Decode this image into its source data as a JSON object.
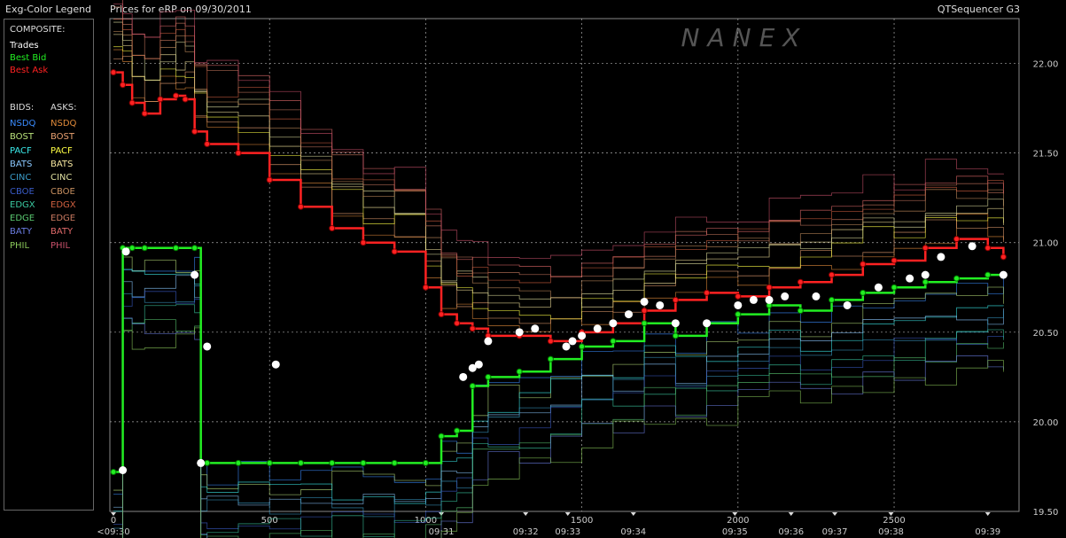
{
  "legend": {
    "title": "Exg-Color Legend",
    "composite_label": "COMPOSITE:",
    "composite": [
      {
        "label": "Trades",
        "color": "#ffffff"
      },
      {
        "label": "Best Bid",
        "color": "#22ee22"
      },
      {
        "label": "Best Ask",
        "color": "#ff2222"
      }
    ],
    "bids_label": "BIDS:",
    "asks_label": "ASKS:",
    "exchanges": [
      {
        "bid": "NSDQ",
        "bid_color": "#3a8cff",
        "ask": "NSDQ",
        "ask_color": "#e08a3a"
      },
      {
        "bid": "BOST",
        "bid_color": "#b8e07a",
        "ask": "BOST",
        "ask_color": "#e8a070"
      },
      {
        "bid": "PACF",
        "bid_color": "#3ae8e8",
        "ask": "PACF",
        "ask_color": "#ffff44"
      },
      {
        "bid": "BATS",
        "bid_color": "#8ac8ff",
        "ask": "BATS",
        "ask_color": "#f8e8a0"
      },
      {
        "bid": "CINC",
        "bid_color": "#3a9cc8",
        "ask": "CINC",
        "ask_color": "#e0e0a0"
      },
      {
        "bid": "CBOE",
        "bid_color": "#3a5cc8",
        "ask": "CBOE",
        "ask_color": "#c89060"
      },
      {
        "bid": "EDGX",
        "bid_color": "#3ac8a0",
        "ask": "EDGX",
        "ask_color": "#d06040"
      },
      {
        "bid": "EDGE",
        "bid_color": "#5ac870",
        "ask": "EDGE",
        "ask_color": "#c87860"
      },
      {
        "bid": "BATY",
        "bid_color": "#6a7ce0",
        "ask": "BATY",
        "ask_color": "#e06a6a"
      },
      {
        "bid": "PHIL",
        "bid_color": "#8ac85a",
        "ask": "PHIL",
        "ask_color": "#c8506a"
      }
    ]
  },
  "header": {
    "title": "Prices for  eRP  on  09/30/2011",
    "app": "QTSequencer G3"
  },
  "watermark": "NANEX",
  "chart_data": {
    "type": "line",
    "title": "Prices for  eRP  on  09/30/2011",
    "xlabel": "",
    "ylabel": "",
    "xlim": [
      0,
      2900
    ],
    "ylim": [
      19.5,
      22.25
    ],
    "x_ticks": [
      0,
      500,
      1000,
      1500,
      2000,
      2500
    ],
    "x_tick_labels": [
      "0",
      "500",
      "1000",
      "1500",
      "2000",
      "2500"
    ],
    "time_ticks": [
      {
        "x": 0,
        "label": "<09:30"
      },
      {
        "x": 1050,
        "label": "09:31"
      },
      {
        "x": 1320,
        "label": "09:32"
      },
      {
        "x": 1455,
        "label": "09:33"
      },
      {
        "x": 1665,
        "label": "09:34"
      },
      {
        "x": 1990,
        "label": "09:35"
      },
      {
        "x": 2170,
        "label": "09:36"
      },
      {
        "x": 2310,
        "label": "09:37"
      },
      {
        "x": 2490,
        "label": "09:38"
      },
      {
        "x": 2800,
        "label": "09:39"
      }
    ],
    "y_ticks": [
      19.5,
      20.0,
      20.5,
      21.0,
      21.5,
      22.0
    ],
    "y_tick_labels": [
      "19.50",
      "20.00",
      "20.50",
      "21.00",
      "21.50",
      "22.00"
    ],
    "grid": true,
    "series": [
      {
        "name": "Best Ask",
        "color": "#ff2222",
        "x": [
          0,
          30,
          60,
          100,
          150,
          200,
          230,
          260,
          300,
          400,
          500,
          600,
          700,
          800,
          900,
          1000,
          1050,
          1100,
          1150,
          1200,
          1300,
          1400,
          1500,
          1600,
          1700,
          1800,
          1900,
          2000,
          2100,
          2200,
          2300,
          2400,
          2500,
          2600,
          2700,
          2800,
          2850
        ],
        "values": [
          21.95,
          21.88,
          21.78,
          21.72,
          21.8,
          21.82,
          21.8,
          21.62,
          21.55,
          21.5,
          21.35,
          21.2,
          21.08,
          21.0,
          20.95,
          20.75,
          20.6,
          20.55,
          20.52,
          20.48,
          20.48,
          20.45,
          20.5,
          20.55,
          20.62,
          20.68,
          20.72,
          20.7,
          20.75,
          20.78,
          20.82,
          20.88,
          20.9,
          20.97,
          21.02,
          20.97,
          20.92
        ]
      },
      {
        "name": "Best Bid",
        "color": "#22ee22",
        "x": [
          0,
          30,
          60,
          100,
          200,
          260,
          280,
          300,
          400,
          500,
          600,
          700,
          800,
          900,
          1000,
          1050,
          1100,
          1150,
          1200,
          1300,
          1400,
          1500,
          1600,
          1700,
          1800,
          1900,
          2000,
          2100,
          2200,
          2300,
          2400,
          2500,
          2600,
          2700,
          2800,
          2850
        ],
        "values": [
          19.72,
          20.97,
          20.97,
          20.97,
          20.97,
          20.97,
          19.77,
          19.77,
          19.77,
          19.77,
          19.77,
          19.77,
          19.77,
          19.77,
          19.77,
          19.92,
          19.95,
          20.2,
          20.25,
          20.28,
          20.35,
          20.42,
          20.45,
          20.55,
          20.48,
          20.55,
          20.6,
          20.65,
          20.62,
          20.68,
          20.72,
          20.75,
          20.78,
          20.8,
          20.82,
          20.82
        ]
      },
      {
        "name": "Trades",
        "color": "#ffffff",
        "x": [
          30,
          40,
          260,
          280,
          300,
          520,
          1120,
          1150,
          1170,
          1200,
          1300,
          1350,
          1450,
          1470,
          1500,
          1550,
          1600,
          1650,
          1700,
          1750,
          1800,
          1900,
          2000,
          2050,
          2100,
          2150,
          2250,
          2350,
          2450,
          2550,
          2600,
          2650,
          2750,
          2850
        ],
        "values": [
          19.73,
          20.95,
          20.82,
          19.77,
          20.42,
          20.32,
          20.25,
          20.3,
          20.32,
          20.45,
          20.5,
          20.52,
          20.42,
          20.45,
          20.48,
          20.52,
          20.55,
          20.6,
          20.67,
          20.65,
          20.55,
          20.55,
          20.65,
          20.68,
          20.68,
          20.7,
          20.7,
          20.65,
          20.75,
          20.8,
          20.82,
          20.92,
          20.98,
          20.82
        ]
      }
    ]
  }
}
